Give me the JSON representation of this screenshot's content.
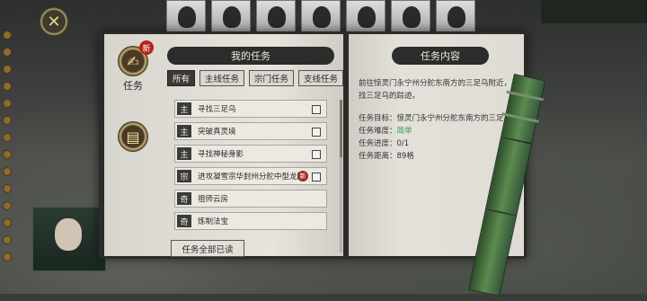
{
  "nav": {
    "close_icon": "crossed-swords-icon"
  },
  "side_tabs": [
    {
      "label": "任务",
      "badge": "新",
      "icon": "scroll-quest-icon"
    },
    {
      "label": "",
      "icon": "paper-stack-icon"
    }
  ],
  "left_page": {
    "title": "我的任务",
    "filters": [
      {
        "label": "所有",
        "active": true
      },
      {
        "label": "主线任务",
        "active": false
      },
      {
        "label": "宗门任务",
        "active": false
      },
      {
        "label": "支线任务",
        "active": false
      }
    ],
    "tasks": [
      {
        "type": "主",
        "name": "寻找三足乌",
        "badge": "",
        "checked": false
      },
      {
        "type": "主",
        "name": "突破真灵境",
        "badge": "",
        "checked": false
      },
      {
        "type": "主",
        "name": "寻找神秘身影",
        "badge": "",
        "checked": false
      },
      {
        "type": "宗",
        "name": "进攻凝雪宗华封州分舵中型龙脉",
        "badge": "新",
        "checked": false
      },
      {
        "type": "奇",
        "name": "祖师云房",
        "badge": "",
        "checked": false
      },
      {
        "type": "奇",
        "name": "炼制法宝",
        "badge": "",
        "checked": false
      }
    ],
    "read_all_label": "任务全部已读"
  },
  "right_page": {
    "title": "任务内容",
    "description": "前往惊灵门永宁州分舵东南方的三足乌附近，寻找三足乌的踪迹。",
    "goal": "任务目标：惊灵门永宁州分舵东南方的三足乌",
    "difficulty_label": "任务难度：",
    "difficulty_value": "简单",
    "progress": "任务进度：0/1",
    "distance": "任务距离：89格"
  },
  "colors": {
    "easy": "#3aa04a",
    "badge": "#b7211b"
  }
}
